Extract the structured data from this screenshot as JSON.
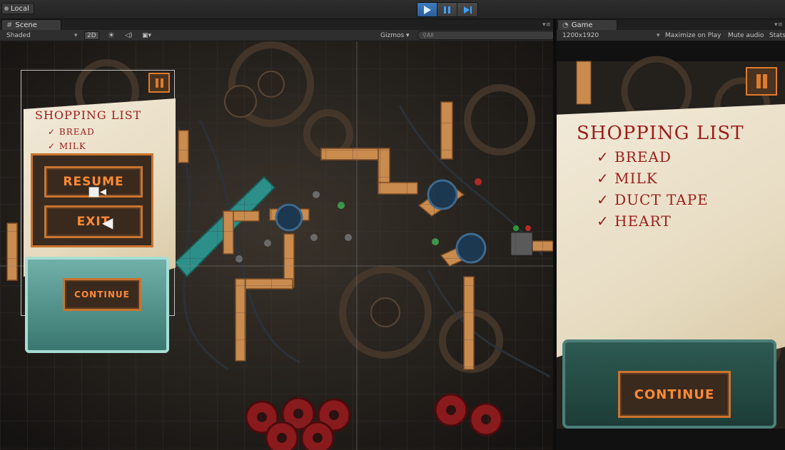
{
  "toolbar": {
    "layers_label": "Local"
  },
  "scene_tab": {
    "label": "Scene"
  },
  "scene_bar": {
    "shading": "Shaded",
    "mode_2d": "2D",
    "gizmos": "Gizmos",
    "search_placeholder": "All"
  },
  "game_tab": {
    "label": "Game"
  },
  "game_bar": {
    "resolution": "1200x1920",
    "maximize": "Maximize on Play",
    "mute": "Mute audio",
    "stats": "Stats"
  },
  "scene_ui": {
    "list_title": "SHOPPING LIST",
    "items": [
      "BREAD",
      "MILK"
    ],
    "resume": "RESUME",
    "exit": "EXIT",
    "continue": "CONTINUE"
  },
  "game_ui": {
    "list_title": "SHOPPING LIST",
    "items": [
      "BREAD",
      "MILK",
      "DUCT TAPE",
      "HEART"
    ],
    "continue": "CONTINUE"
  },
  "colors": {
    "accent_blue": "#3fa2ff",
    "wood_orange": "#e07a2c",
    "ink_red": "#9b1d1b",
    "paper": "#efe6d2",
    "teal": "#2c8f8a"
  }
}
